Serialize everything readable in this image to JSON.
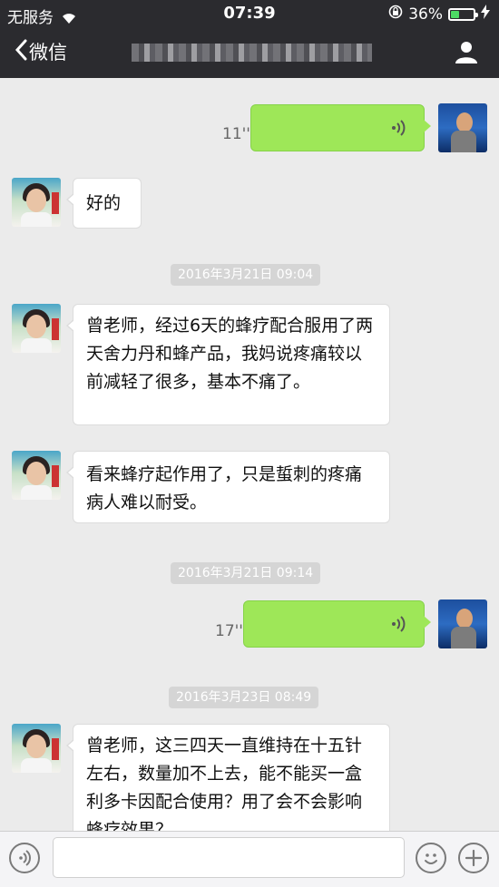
{
  "status_bar": {
    "carrier": "无服务",
    "time": "07:39",
    "battery_percent": "36%",
    "battery_level": 0.36
  },
  "nav": {
    "back_label": "微信"
  },
  "messages": [
    {
      "duration": "11''"
    },
    {
      "text": "好的"
    },
    {
      "timestamp": "2016年3月21日 09:04"
    },
    {
      "text": "曾老师，经过6天的蜂疗配合服用了两天舍力丹和蜂产品，我妈说疼痛较以前减轻了很多，基本不痛了。"
    },
    {
      "text": "看来蜂疗起作用了，只是蜇刺的疼痛病人难以耐受。"
    },
    {
      "timestamp": "2016年3月21日 09:14"
    },
    {
      "duration": "17''"
    },
    {
      "timestamp": "2016年3月23日 08:49"
    },
    {
      "text": "曾老师，这三四天一直维持在十五针左右，数量加不上去，能不能买一盒利多卡因配合使用？用了会不会影响蜂疗效果？"
    }
  ],
  "colors": {
    "voice_bubble": "#9ee758",
    "chat_bg": "#ebebeb",
    "bar": "#2b2b2f"
  }
}
